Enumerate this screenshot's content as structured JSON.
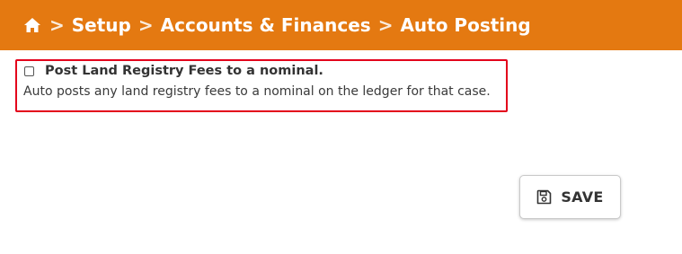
{
  "breadcrumb": {
    "home_icon": "home-icon",
    "separator": ">",
    "items": [
      "Setup",
      "Accounts & Finances",
      "Auto Posting"
    ]
  },
  "option": {
    "checked": false,
    "title": "Post Land Registry Fees to a nominal.",
    "description": "Auto posts any land registry fees to a nominal on the ledger for that case."
  },
  "actions": {
    "save_icon": "floppy-disk-icon",
    "save_label": "SAVE"
  },
  "colors": {
    "header_bg": "#e47911",
    "highlight_border": "#e3001b"
  }
}
